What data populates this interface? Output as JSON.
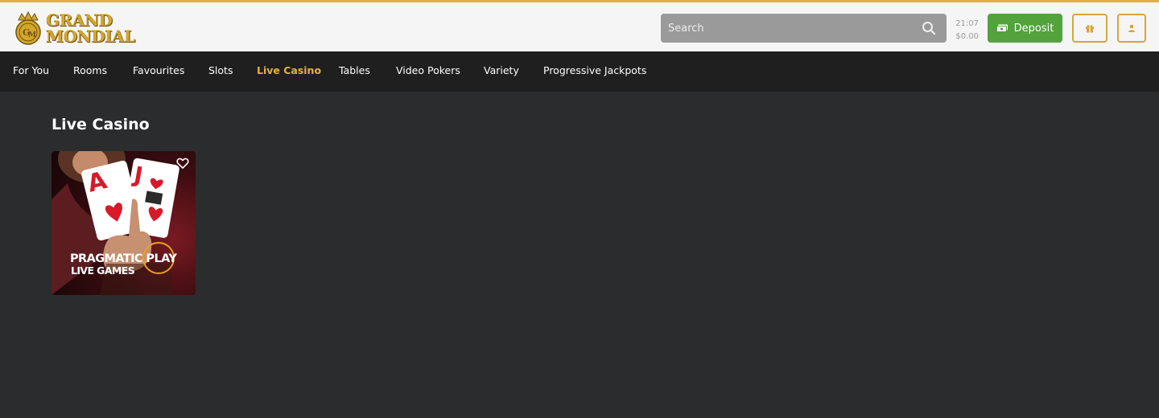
{
  "header": {
    "logo_line1": "GRAND",
    "logo_line2": "MONDIAL",
    "search_placeholder": "Search",
    "time": "21:07",
    "balance": "$0.00",
    "deposit_label": "Deposit"
  },
  "nav": {
    "items": [
      {
        "label": "For You",
        "active": false
      },
      {
        "label": "Rooms",
        "active": false
      },
      {
        "label": "Favourites",
        "active": false
      },
      {
        "label": "Slots",
        "active": false
      },
      {
        "label": "Live Casino",
        "active": true
      },
      {
        "label": "Tables",
        "active": false
      },
      {
        "label": "Video Pokers",
        "active": false
      },
      {
        "label": "Variety",
        "active": false
      },
      {
        "label": "Progressive Jackpots",
        "active": false
      }
    ]
  },
  "main": {
    "section_title": "Live Casino",
    "games": [
      {
        "brand_line1": "PRAGMATIC",
        "brand_line2": "LIVE GAMES",
        "brand_play": "PLAY",
        "card1_rank": "A",
        "card2_rank": "J"
      }
    ]
  },
  "colors": {
    "accent": "#e5b436",
    "deposit": "#52a33c",
    "nav_bg": "#1f1f20",
    "page_bg": "#2b2c2e"
  }
}
